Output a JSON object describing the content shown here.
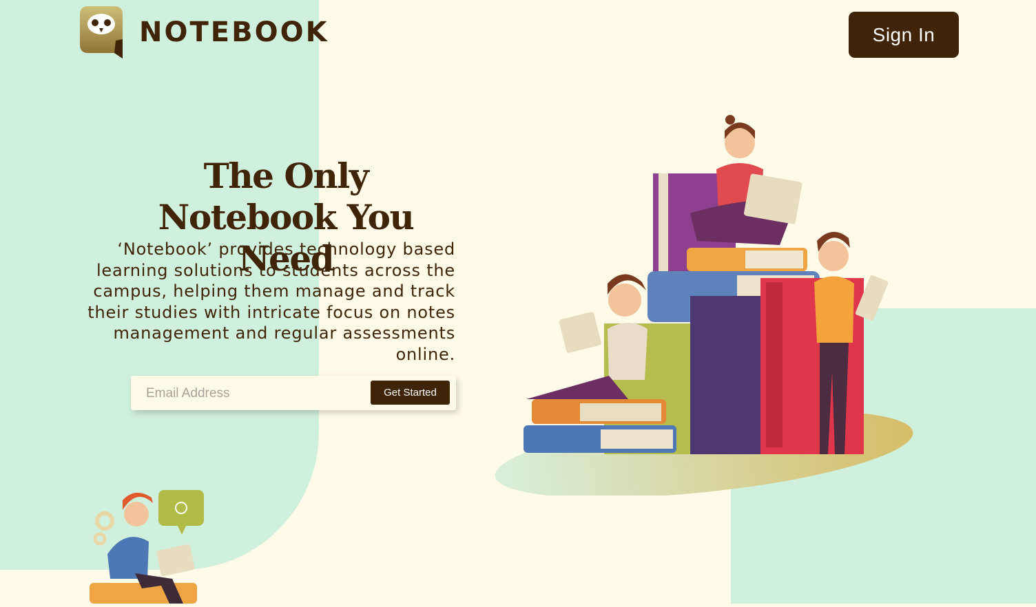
{
  "brand": {
    "name": "NOTEBOOK",
    "logo_icon": "owl-icon"
  },
  "header": {
    "signin_label": "Sign In"
  },
  "hero": {
    "title": "The Only Notebook You Need",
    "description": "‘Notebook’ provides technology based learning solutions to students across the campus, helping them manage and track their studies with intricate focus on notes management and regular assessments online."
  },
  "signup": {
    "email_placeholder": "Email Address",
    "cta_label": "Get Started"
  },
  "colors": {
    "brand_dark": "#3f2408",
    "mint": "#cff0dc",
    "cream": "#fffbe8"
  },
  "illustrations": {
    "main": "students-reading-on-books-illustration",
    "secondary": "student-with-idea-illustration"
  }
}
